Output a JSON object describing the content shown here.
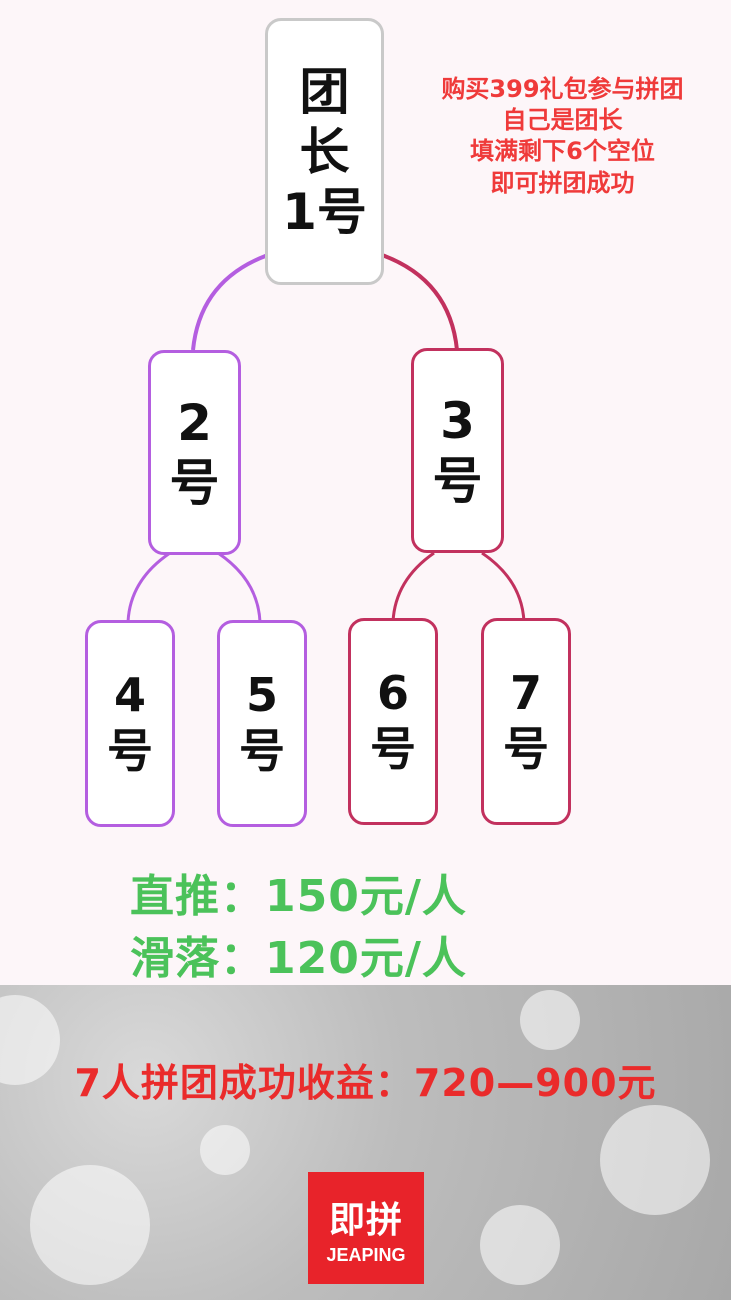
{
  "root": {
    "line1": "团",
    "line2": "长",
    "line3": "1号"
  },
  "nodes": {
    "n2": {
      "num": "2",
      "unit": "号"
    },
    "n3": {
      "num": "3",
      "unit": "号"
    },
    "n4": {
      "num": "4",
      "unit": "号"
    },
    "n5": {
      "num": "5",
      "unit": "号"
    },
    "n6": {
      "num": "6",
      "unit": "号"
    },
    "n7": {
      "num": "7",
      "unit": "号"
    }
  },
  "note": {
    "line1": "购买399礼包参与拼团",
    "line2": "自己是团长",
    "line3": "填满剩下6个空位",
    "line4": "即可拼团成功"
  },
  "rewards": {
    "direct": "直推：150元/人",
    "spillover": "滑落：120元/人"
  },
  "summary": "7人拼团成功收益：720—900元",
  "logo": {
    "cn": "即拼",
    "en": "JEAPING"
  },
  "colors": {
    "left_branch": "#b45ee0",
    "right_branch": "#c2315e",
    "green_text": "#4bc25a",
    "red_text": "#ea2b2b",
    "logo_bg": "#e8232a"
  }
}
